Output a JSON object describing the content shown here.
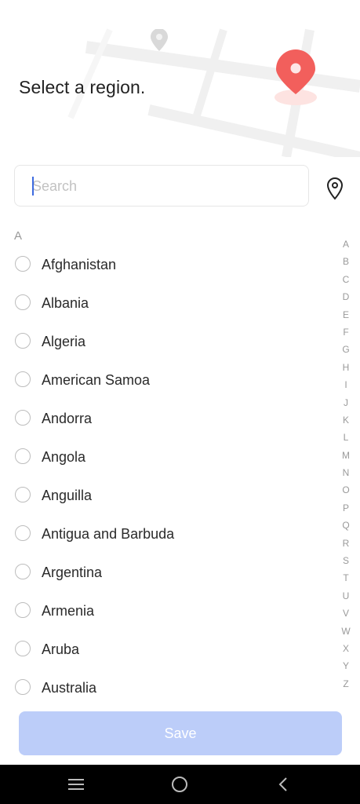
{
  "header": {
    "title": "Select a region."
  },
  "search": {
    "placeholder": "Search",
    "value": ""
  },
  "list": {
    "section_letter": "A",
    "items": [
      "Afghanistan",
      "Albania",
      "Algeria",
      "American Samoa",
      "Andorra",
      "Angola",
      "Anguilla",
      "Antigua and Barbuda",
      "Argentina",
      "Armenia",
      "Aruba",
      "Australia"
    ]
  },
  "index_letters": [
    "A",
    "B",
    "C",
    "D",
    "E",
    "F",
    "G",
    "H",
    "I",
    "J",
    "K",
    "L",
    "M",
    "N",
    "O",
    "P",
    "Q",
    "R",
    "S",
    "T",
    "U",
    "V",
    "W",
    "X",
    "Y",
    "Z"
  ],
  "actions": {
    "save_label": "Save"
  },
  "icons": {
    "locate": "location-pin-icon",
    "header_pin": "map-pin-icon",
    "nav_menu": "menu-icon",
    "nav_home": "home-circle-icon",
    "nav_back": "back-chevron-icon"
  },
  "colors": {
    "accent_pin": "#f25f5c",
    "save_disabled": "#bccdf9",
    "caret": "#3d6be0"
  }
}
